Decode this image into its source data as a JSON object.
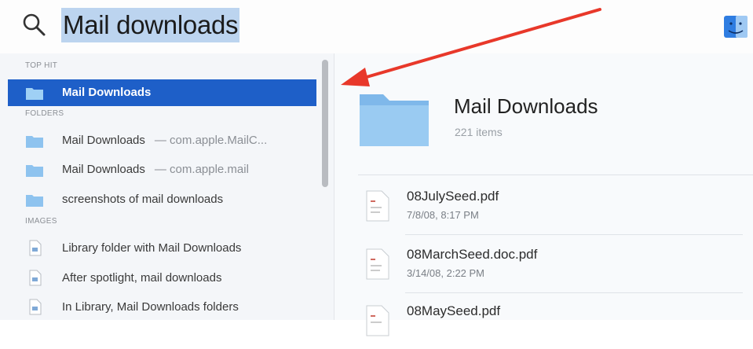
{
  "search": {
    "query": "Mail downloads"
  },
  "results": {
    "sections": [
      {
        "header": "TOP HIT",
        "items": [
          {
            "label": "Mail Downloads",
            "sub": "",
            "icon": "folder-icon",
            "selected": true
          }
        ]
      },
      {
        "header": "FOLDERS",
        "items": [
          {
            "label": "Mail Downloads",
            "sub": "— com.apple.MailC...",
            "icon": "folder-icon"
          },
          {
            "label": "Mail Downloads",
            "sub": "— com.apple.mail",
            "icon": "folder-icon"
          },
          {
            "label": "screenshots of mail downloads",
            "sub": "",
            "icon": "folder-icon"
          }
        ]
      },
      {
        "header": "IMAGES",
        "items": [
          {
            "label": "Library folder with Mail Downloads",
            "sub": "",
            "icon": "image-file-icon"
          },
          {
            "label": "After spotlight, mail downloads",
            "sub": "",
            "icon": "image-file-icon"
          },
          {
            "label": "In Library, Mail Downloads folders",
            "sub": "",
            "icon": "image-file-icon"
          }
        ]
      }
    ]
  },
  "preview": {
    "title": "Mail Downloads",
    "count": "221 items",
    "files": [
      {
        "name": "08JulySeed.pdf",
        "date": "7/8/08, 8:17 PM"
      },
      {
        "name": "08MarchSeed.doc.pdf",
        "date": "3/14/08, 2:22 PM"
      },
      {
        "name": "08MaySeed.pdf",
        "date": ""
      }
    ]
  },
  "colors": {
    "selection": "#1e5fc8",
    "search_highlight": "#bcd4ef",
    "annotation_arrow": "#e8382a",
    "folder": "#8ec3ef"
  }
}
